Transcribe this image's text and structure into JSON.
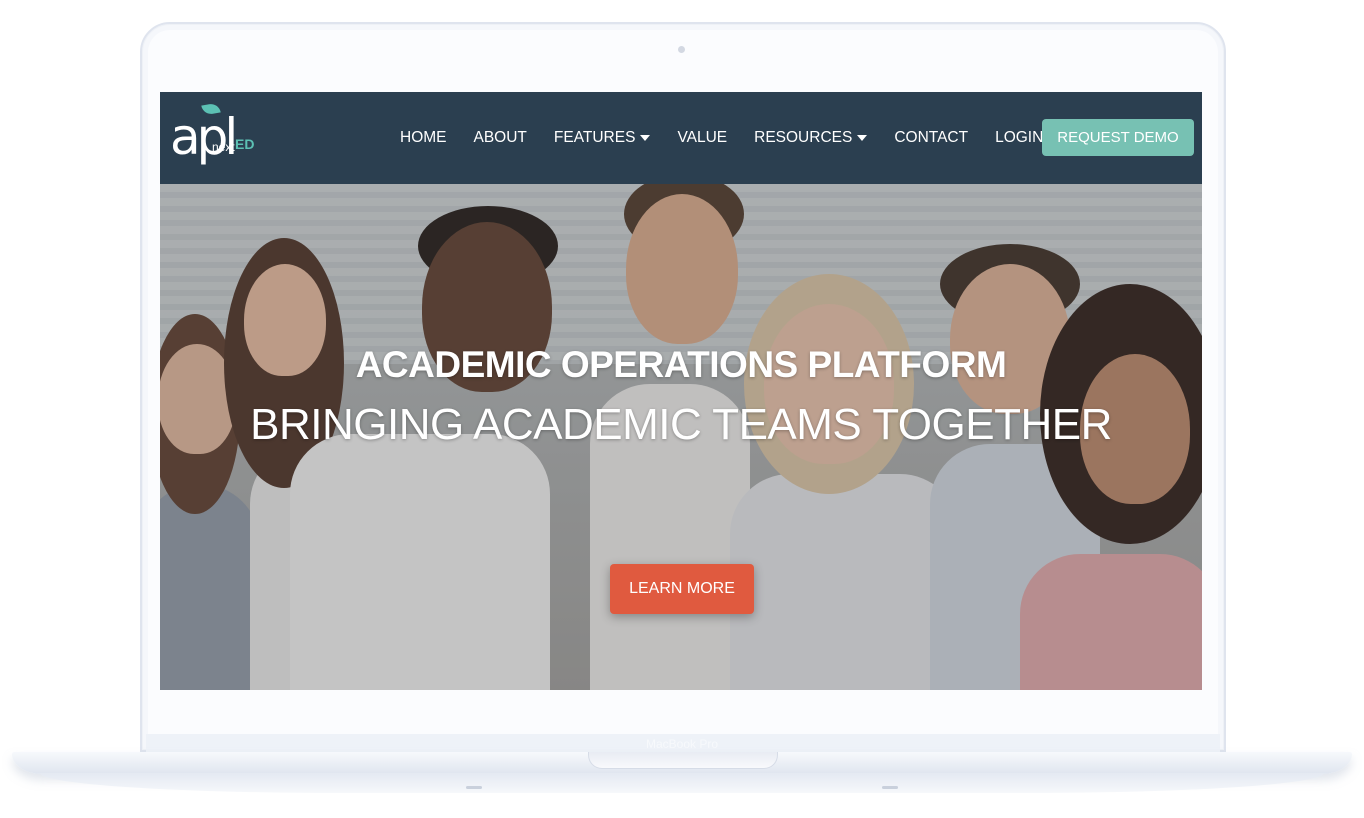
{
  "device": {
    "model_label": "MacBook Pro"
  },
  "site": {
    "logo": {
      "main_text": "apl",
      "sub_text": "next",
      "accent_text": "ED"
    },
    "nav": {
      "items": [
        {
          "label": "HOME",
          "has_dropdown": false
        },
        {
          "label": "ABOUT",
          "has_dropdown": false
        },
        {
          "label": "FEATURES",
          "has_dropdown": true
        },
        {
          "label": "VALUE",
          "has_dropdown": false
        },
        {
          "label": "RESOURCES",
          "has_dropdown": true
        },
        {
          "label": "CONTACT",
          "has_dropdown": false
        },
        {
          "label": "LOGIN",
          "has_dropdown": true
        }
      ],
      "cta_label": "REQUEST DEMO"
    },
    "hero": {
      "title": "ACADEMIC OPERATIONS PLATFORM",
      "subtitle": "BRINGING ACADEMIC TEAMS TOGETHER",
      "button_label": "LEARN MORE"
    }
  },
  "colors": {
    "navbar_bg": "#2b3f50",
    "cta_bg": "#77c1b3",
    "hero_button_bg": "#e05a3f",
    "logo_accent": "#5cc1b4"
  }
}
